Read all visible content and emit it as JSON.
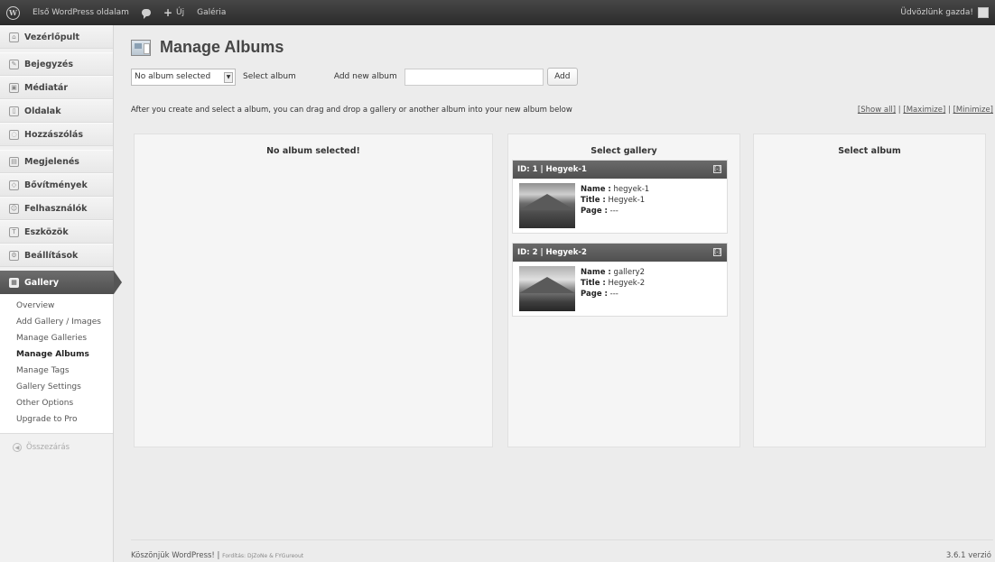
{
  "adminbar": {
    "site_name": "Első WordPress oldalam",
    "new_label": "Új",
    "gallery_label": "Galéria",
    "greeting": "Üdvözlünk gazda!"
  },
  "sidebar": {
    "items": [
      {
        "label": "Vezérlőpult",
        "icon": "dashboard-icon"
      },
      {
        "label": "Bejegyzés",
        "icon": "pin-icon"
      },
      {
        "label": "Médiatár",
        "icon": "media-icon"
      },
      {
        "label": "Oldalak",
        "icon": "page-icon"
      },
      {
        "label": "Hozzászólás",
        "icon": "comment-icon"
      },
      {
        "label": "Megjelenés",
        "icon": "appearance-icon"
      },
      {
        "label": "Bővítmények",
        "icon": "plugin-icon"
      },
      {
        "label": "Felhasználók",
        "icon": "users-icon"
      },
      {
        "label": "Eszközök",
        "icon": "tools-icon"
      },
      {
        "label": "Beállítások",
        "icon": "settings-icon"
      }
    ],
    "active": {
      "label": "Gallery",
      "icon": "gallery-icon"
    },
    "submenu": [
      "Overview",
      "Add Gallery / Images",
      "Manage Galleries",
      "Manage Albums",
      "Manage Tags",
      "Gallery Settings",
      "Other Options",
      "Upgrade to Pro"
    ],
    "current_submenu": "Manage Albums",
    "collapse_label": "Összezárás"
  },
  "main": {
    "title": "Manage Albums",
    "album_select_value": "No album selected",
    "select_album_label": "Select album",
    "add_new_album_label": "Add new album",
    "add_new_album_value": "",
    "add_button": "Add",
    "info_text": "After you create and select a album, you can drag and drop a gallery or another album into your new album below",
    "view_links": {
      "show_all": "[Show all]",
      "sep1": " | ",
      "maximize": "[Maximize]",
      "sep2": " | ",
      "minimize": "[Minimize]"
    },
    "panels": {
      "album": {
        "title": "No album selected!"
      },
      "gallery": {
        "title": "Select gallery"
      },
      "select_album": {
        "title": "Select album"
      }
    },
    "galleries": [
      {
        "header": "ID: 1 | Hegyek-1",
        "toggle": "[-]",
        "name_label": "Name :",
        "name": "hegyek-1",
        "title_label": "Title :",
        "title": "Hegyek-1",
        "page_label": "Page :",
        "page": "---"
      },
      {
        "header": "ID: 2 | Hegyek-2",
        "toggle": "[-]",
        "name_label": "Name :",
        "name": "gallery2",
        "title_label": "Title :",
        "title": "Hegyek-2",
        "page_label": "Page :",
        "page": "---"
      }
    ]
  },
  "footer": {
    "thanks": "Köszönjük WordPress!",
    "sep": " | ",
    "translators": "Fordítás: DjZoNe & FYGureout",
    "version": "3.6.1 verzió"
  }
}
